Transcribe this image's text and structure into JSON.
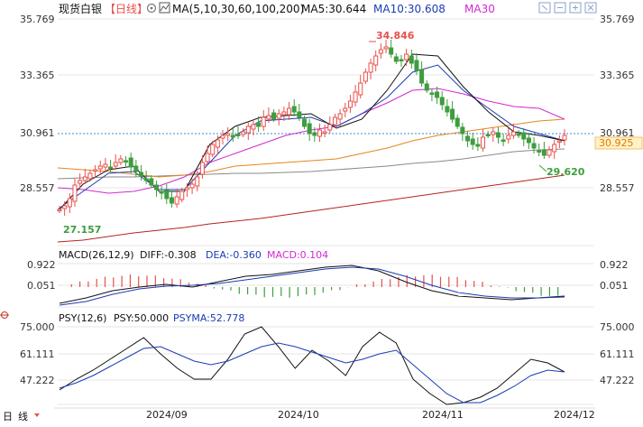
{
  "header": {
    "title": "现货白银",
    "period_label": "【日线】",
    "ma_params": "MA(5,10,30,60,100,200)",
    "ma5": "MA5:30.644",
    "ma10": "MA10:30.608",
    "ma30": "MA30"
  },
  "price_axis": {
    "ticks": [
      "35.769",
      "33.365",
      "30.961",
      "28.557"
    ],
    "current_price": "30.925",
    "ref_line": "30.961",
    "max_label": "34.846",
    "min_label": "27.157",
    "low_label": "29.620"
  },
  "macd": {
    "header": "MACD(26,12,9)",
    "diff": "DIFF:-0.308",
    "dea": "DEA:-0.360",
    "macd": "MACD:0.104",
    "ticks": [
      "0.922",
      "0.051"
    ]
  },
  "psy": {
    "header": "PSY(12,6)",
    "psy": "PSY:50.000",
    "psyma": "PSYMA:52.778",
    "ticks": [
      "75.000",
      "61.111",
      "47.222"
    ]
  },
  "x_axis": {
    "labels": [
      "2024/09",
      "2024/10",
      "2024/11",
      "2024/12"
    ]
  },
  "footer": {
    "mode": "线"
  },
  "colors": {
    "up": "#e8504a",
    "down": "#3e9d3e",
    "ma5": "#111111",
    "ma10": "#1b3cb3",
    "ma30": "#d228d2",
    "ma60": "#e7861d",
    "ma100": "#8a8a8a",
    "ma200": "#b3261e",
    "price_badge_bg": "#fff2c7",
    "price_badge_fg": "#e07a00",
    "ref_line": "#3a8fd1"
  },
  "chart_data": {
    "type": "candlestick",
    "categories": [
      "2024/08-2024/12 daily"
    ],
    "price_range": [
      26.7,
      36.4
    ],
    "series_names": [
      "MA5",
      "MA10",
      "MA30"
    ]
  }
}
